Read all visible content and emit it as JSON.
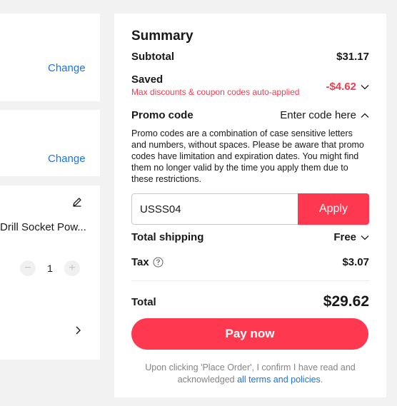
{
  "left": {
    "address_change": "Change",
    "payment_change": "Change",
    "item": {
      "title": "Drill Socket Pow...",
      "quantity": "1",
      "minus": "−",
      "plus": "+"
    }
  },
  "summary": {
    "title": "Summary",
    "subtotal_label": "Subtotal",
    "subtotal_value": "$31.17",
    "saved_label": "Saved",
    "saved_note": "Max discounts & coupon codes auto-applied",
    "saved_value": "-$4.62",
    "promo_label": "Promo code",
    "promo_action": "Enter code here",
    "promo_desc": "Promo codes are a combination of case sensitive letters and numbers, without spaces. Please be aware that promo codes have limitation and expiration dates. You might find them no longer valid by the time you apply them due to these restrictions.",
    "promo_input_value": "USSS04",
    "apply_label": "Apply",
    "shipping_label": "Total shipping",
    "shipping_value": "Free",
    "tax_label": "Tax",
    "tax_value": "$3.07",
    "total_label": "Total",
    "total_value": "$29.62",
    "pay_label": "Pay now",
    "notice_text": "Upon clicking 'Place Order', I confirm I have read and acknowledged ",
    "notice_link": "all terms and policies",
    "notice_end": "."
  },
  "colors": {
    "accent": "#fd384f",
    "link": "#1a73e8"
  }
}
